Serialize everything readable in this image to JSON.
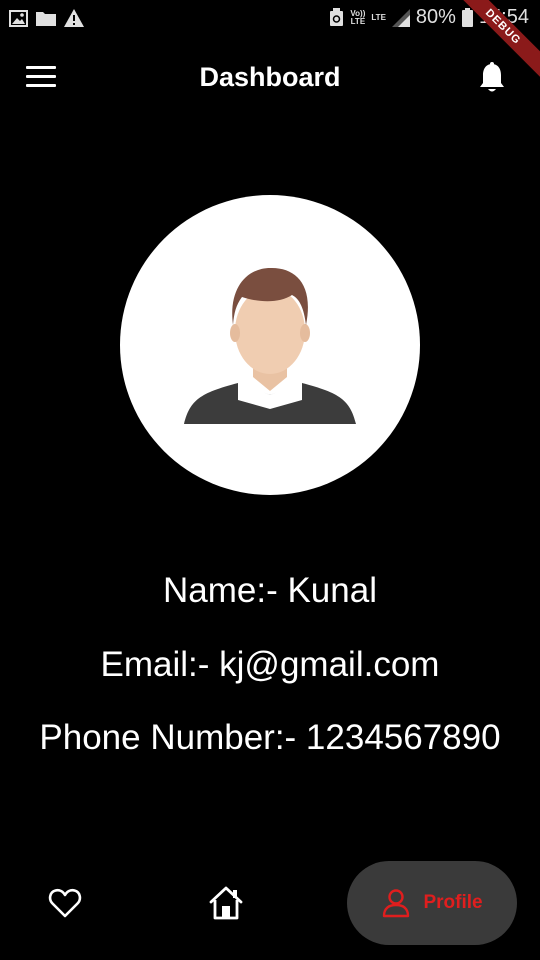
{
  "status_bar": {
    "battery": "80%",
    "time": "15:54",
    "volte": "Vo))\nLTE",
    "lte": "LTE"
  },
  "debug_banner": "DEBUG",
  "app_bar": {
    "title": "Dashboard"
  },
  "profile": {
    "name_line": "Name:- Kunal",
    "email_line": "Email:- kj@gmail.com",
    "phone_line": "Phone Number:- 1234567890"
  },
  "bottom_nav": {
    "items": [
      {
        "icon": "heart-icon"
      },
      {
        "icon": "home-icon"
      },
      {
        "icon": "person-icon",
        "label": "Profile"
      }
    ]
  },
  "colors": {
    "background": "#000000",
    "text": "#ffffff",
    "accent": "#e01e1e",
    "active_pill": "#3a3a3a",
    "avatar_bg": "#ffffff",
    "debug_ribbon": "#8b1a1a"
  }
}
